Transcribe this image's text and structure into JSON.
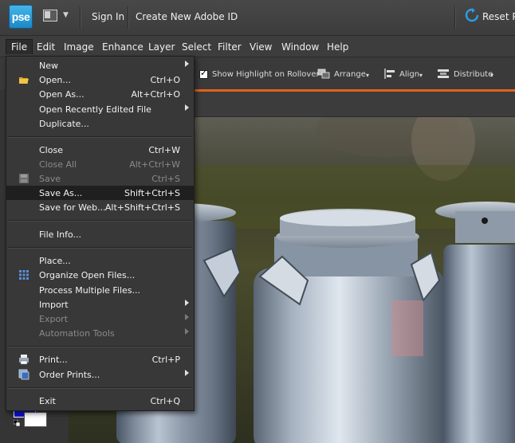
{
  "topbar": {
    "logo": "pse",
    "sign_in": "Sign In",
    "create_id": "Create New Adobe ID",
    "reset": "Reset Pa"
  },
  "menubar": [
    "File",
    "Edit",
    "Image",
    "Enhance",
    "Layer",
    "Select",
    "Filter",
    "View",
    "Window",
    "Help"
  ],
  "options": {
    "show_highlight": "Show Highlight on Rollover",
    "arrange": "Arrange",
    "align": "Align",
    "distribute": "Distribute"
  },
  "file_menu": {
    "new": {
      "label": "New"
    },
    "open": {
      "label": "Open...",
      "shortcut": "Ctrl+O"
    },
    "open_as": {
      "label": "Open As...",
      "shortcut": "Alt+Ctrl+O"
    },
    "open_recent": {
      "label": "Open Recently Edited File"
    },
    "duplicate": {
      "label": "Duplicate..."
    },
    "close": {
      "label": "Close",
      "shortcut": "Ctrl+W"
    },
    "close_all": {
      "label": "Close All",
      "shortcut": "Alt+Ctrl+W"
    },
    "save": {
      "label": "Save",
      "shortcut": "Ctrl+S"
    },
    "save_as": {
      "label": "Save As...",
      "shortcut": "Shift+Ctrl+S"
    },
    "save_web": {
      "label": "Save for Web...",
      "shortcut": "Alt+Shift+Ctrl+S"
    },
    "file_info": {
      "label": "File Info..."
    },
    "place": {
      "label": "Place..."
    },
    "organize": {
      "label": "Organize Open Files..."
    },
    "process_multiple": {
      "label": "Process Multiple Files..."
    },
    "import": {
      "label": "Import"
    },
    "export": {
      "label": "Export"
    },
    "automation": {
      "label": "Automation Tools"
    },
    "print": {
      "label": "Print...",
      "shortcut": "Ctrl+P"
    },
    "order_prints": {
      "label": "Order Prints..."
    },
    "exit": {
      "label": "Exit",
      "shortcut": "Ctrl+Q"
    }
  },
  "colors": {
    "accent_orange": "#e2631c",
    "menu_highlight": "#1f1f1f",
    "foreground_color": "#1010e0",
    "background_color": "#ffffff"
  }
}
